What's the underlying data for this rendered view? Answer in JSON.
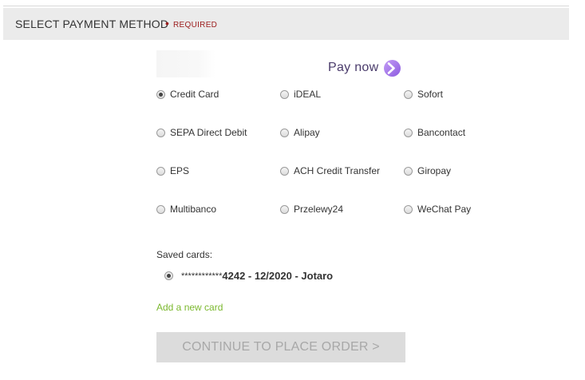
{
  "header": {
    "title": "SELECT PAYMENT METHOD",
    "required_dot": "•",
    "required_label": "REQUIRED"
  },
  "provider": {
    "pay_now_text": "Pay now",
    "pay_now_icon": "chevron-right-circle-icon",
    "brand_color": "#a87be8"
  },
  "methods": [
    {
      "label": "Credit Card",
      "selected": true
    },
    {
      "label": "iDEAL",
      "selected": false
    },
    {
      "label": "Sofort",
      "selected": false
    },
    {
      "label": "SEPA Direct Debit",
      "selected": false
    },
    {
      "label": "Alipay",
      "selected": false
    },
    {
      "label": "Bancontact",
      "selected": false
    },
    {
      "label": "EPS",
      "selected": false
    },
    {
      "label": "ACH Credit Transfer",
      "selected": false
    },
    {
      "label": "Giropay",
      "selected": false
    },
    {
      "label": "Multibanco",
      "selected": false
    },
    {
      "label": "Przelewy24",
      "selected": false
    },
    {
      "label": "WeChat Pay",
      "selected": false
    }
  ],
  "saved_cards": {
    "label": "Saved cards:",
    "cards": [
      {
        "mask": "************",
        "detail": "4242 - 12/2020 - Jotaro",
        "selected": true
      }
    ]
  },
  "add_card_label": "Add a new card",
  "continue_button": {
    "label": "CONTINUE TO PLACE ORDER >",
    "enabled": false
  },
  "colors": {
    "required": "#9b1c1c",
    "link": "#7bb82e",
    "header_bg": "#ebebeb",
    "button_disabled_bg": "#dcdcdc",
    "button_disabled_text": "#a8a8a8"
  }
}
